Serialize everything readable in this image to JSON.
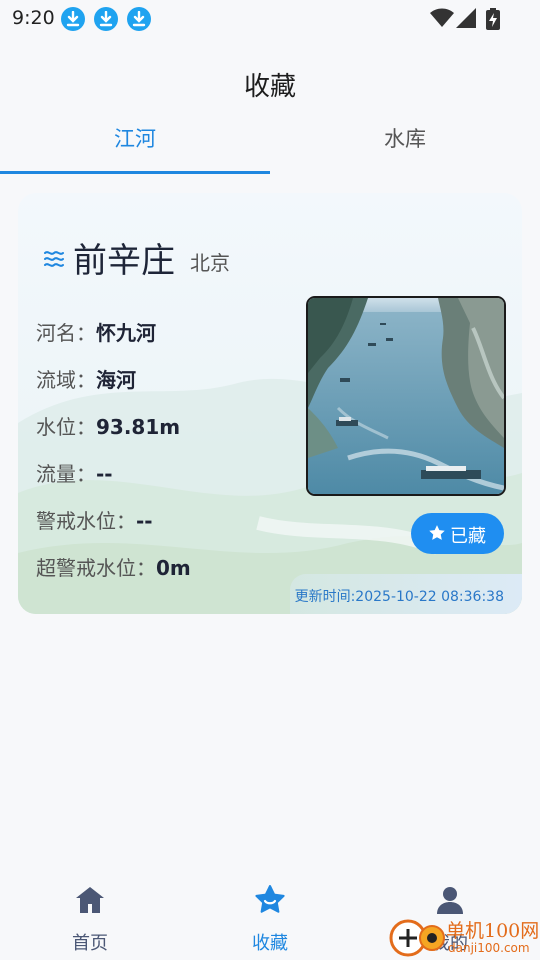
{
  "status_bar": {
    "time": "9:20"
  },
  "header": {
    "title": "收藏"
  },
  "tabs": [
    {
      "label": "江河",
      "active": true
    },
    {
      "label": "水库",
      "active": false
    }
  ],
  "card": {
    "name": "前辛庄",
    "city": "北京",
    "fields": [
      {
        "label": "河名：",
        "value": "怀九河"
      },
      {
        "label": "流域：",
        "value": "海河"
      },
      {
        "label": "水位：",
        "value": "93.81m"
      },
      {
        "label": "流量：",
        "value": "--"
      },
      {
        "label": "警戒水位：",
        "value": "--"
      },
      {
        "label": "超警戒水位：",
        "value": "0m"
      }
    ],
    "saved_label": "已藏",
    "update_time": "更新时间:2025-10-22 08:36:38"
  },
  "bottom_nav": [
    {
      "label": "首页",
      "icon": "home-icon",
      "active": false
    },
    {
      "label": "收藏",
      "icon": "star-icon",
      "active": true
    },
    {
      "label": "我的",
      "icon": "user-icon",
      "active": false
    }
  ],
  "watermark": {
    "line1": "单机100网",
    "line2": "danji100.com"
  },
  "colors": {
    "accent": "#1f87e0",
    "nav_inactive": "#4b5775",
    "status_download": "#1fa3f0"
  }
}
